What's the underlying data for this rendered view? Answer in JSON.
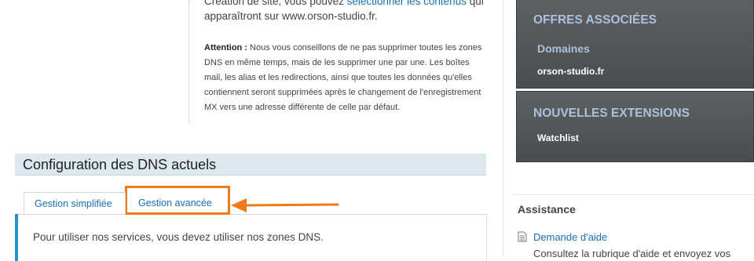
{
  "intro": {
    "line1_prefix": "Création de site, vous pouvez ",
    "line1_link": "sélectionner les contenus",
    "line1_suffix": " qui",
    "line2": "apparaîtront sur www.orson-studio.fr."
  },
  "warning": {
    "label": "Attention :",
    "text": " Nous vous conseillons de ne pas supprimer toutes les zones DNS en même temps, mais de les supprimer une par une. Les boîtes mail, les alias et les redirections, ainsi que toutes les données qu'elles contiennent seront supprimées après le changement de l'enregistrement MX vers une adresse différente de celle par défaut."
  },
  "dns_section": {
    "title": "Configuration des DNS actuels",
    "tabs": [
      {
        "label": "Gestion simplifiée",
        "active": true
      },
      {
        "label": "Gestion avancée",
        "active": false
      }
    ],
    "panel_text": "Pour utiliser nos services, vous devez utiliser nos zones DNS."
  },
  "sidebar": {
    "offers": {
      "title": "OFFRES ASSOCIÉES",
      "subtitle": "Domaines",
      "item": "orson-studio.fr"
    },
    "extensions": {
      "title": "NOUVELLES EXTENSIONS",
      "item": "Watchlist"
    },
    "assistance": {
      "title": "Assistance",
      "link": "Demande d'aide",
      "desc": "Consultez la rubrique d'aide et envoyez vos"
    }
  },
  "colors": {
    "highlight": "#f07a1a",
    "link": "#1a6fb3",
    "panel_accent": "#2a93c9",
    "sidebar_dark": "#555658",
    "sidebar_heading": "#a8c2dd"
  },
  "icons": [
    "arrow-left-icon",
    "document-icon"
  ]
}
